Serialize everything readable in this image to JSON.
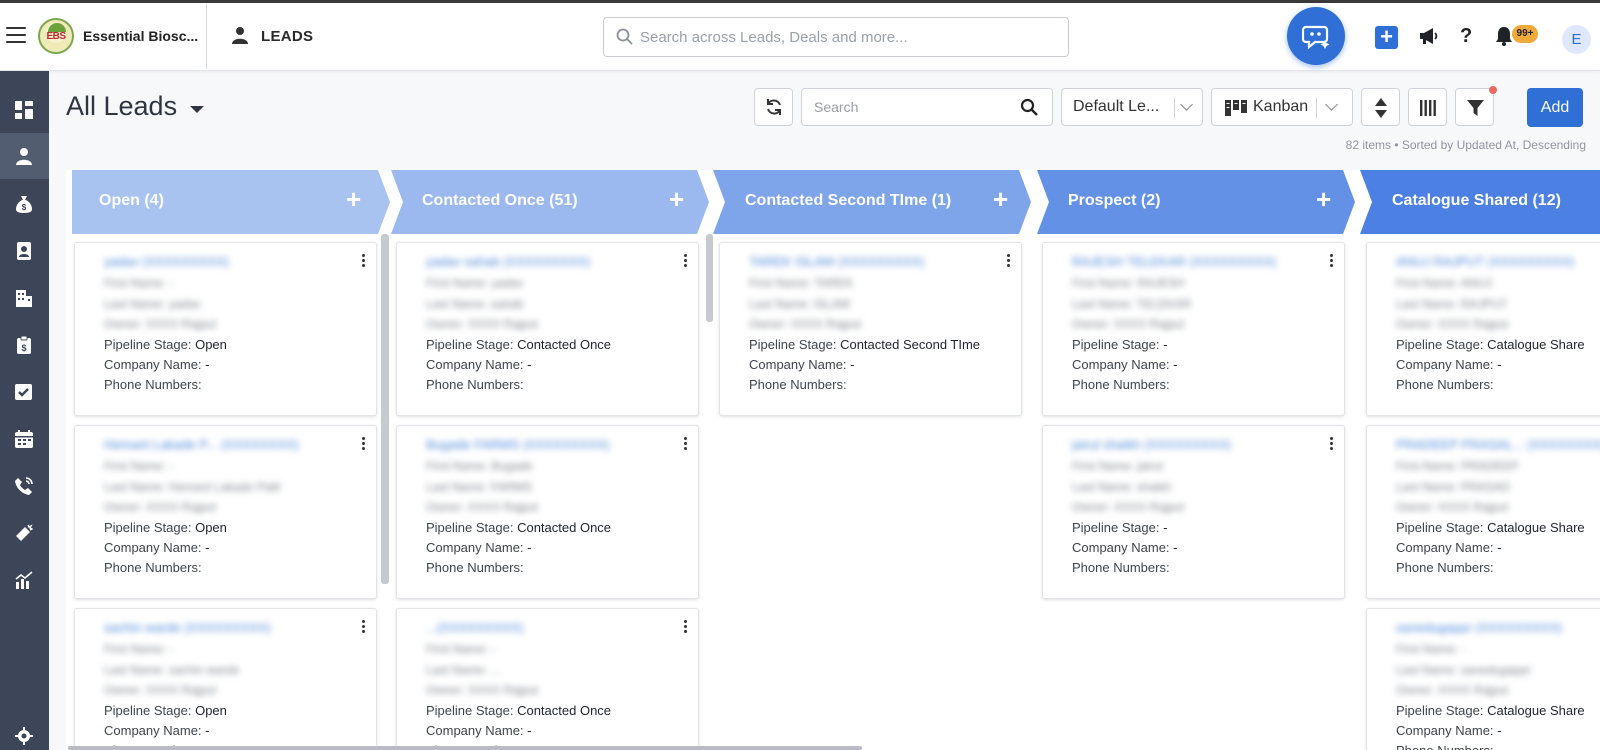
{
  "header": {
    "company_name": "Essential Biosc...",
    "logo_text": "EBS",
    "module_title": "LEADS",
    "search_placeholder": "Search across Leads, Deals and more...",
    "notification_badge": "99+",
    "avatar_initial": "E"
  },
  "sidebar": {
    "items": [
      {
        "icon": "dashboard-icon",
        "active": false
      },
      {
        "icon": "leads-person-icon",
        "active": true
      },
      {
        "icon": "deals-moneybag-icon",
        "active": false
      },
      {
        "icon": "contacts-icon",
        "active": false
      },
      {
        "icon": "companies-building-icon",
        "active": false
      },
      {
        "icon": "clipboard-icon",
        "active": false
      },
      {
        "icon": "tasks-checkbox-icon",
        "active": false
      },
      {
        "icon": "calendar-icon",
        "active": false
      },
      {
        "icon": "calls-icon",
        "active": false
      },
      {
        "icon": "campaigns-megaphone-icon",
        "active": false
      },
      {
        "icon": "reports-chart-icon",
        "active": false
      },
      {
        "icon": "settings-gear-icon",
        "active": false
      }
    ]
  },
  "toolbar": {
    "page_title": "All Leads",
    "search_placeholder": "Search",
    "view_select": "Default Le...",
    "layout_select": "Kanban",
    "add_label": "Add",
    "items_info": "82 items • Sorted by Updated At, Descending"
  },
  "labels": {
    "pipeline_stage": "Pipeline Stage: ",
    "company_name": "Company Name: ",
    "phone_numbers": "Phone Numbers:"
  },
  "stages": [
    {
      "label": "Open (4)",
      "color": "#a9c3f1",
      "cards": [
        {
          "name": "yadav (XXXXXXXXX)",
          "first": "First Name: -",
          "last": "Last Name: yadav",
          "owner": "Owner: XXXX Rajput",
          "stage": "Open",
          "company": "-"
        },
        {
          "name": "Hemant Lakade P... (XXXXXXXX)",
          "first": "First Name: -",
          "last": "Last Name: Hemant Lakade Patil",
          "owner": "Owner: XXXX Rajput",
          "stage": "Open",
          "company": "-"
        },
        {
          "name": "sachin warde (XXXXXXXXX)",
          "first": "First Name: -",
          "last": "Last Name: sachin warde",
          "owner": "Owner: XXXX Rajput",
          "stage": "Open",
          "company": "-"
        }
      ]
    },
    {
      "label": "Contacted Once (51)",
      "color": "#9bb9ef",
      "cards": [
        {
          "name": "yadav sahab (XXXXXXXXX)",
          "first": "First Name: yadav",
          "last": "Last Name: sahab",
          "owner": "Owner: XXXX Rajput",
          "stage": "Contacted Once",
          "company": "-"
        },
        {
          "name": "Bugade FARMS (XXXXXXXXX)",
          "first": "First Name: Bugade",
          "last": "Last Name: FARMS",
          "owner": "Owner: XXXX Rajput",
          "stage": "Contacted Once",
          "company": "-"
        },
        {
          "name": "...(XXXXXXXXX)",
          "first": "First Name: -",
          "last": "Last Name: ...",
          "owner": "Owner: XXXX Rajput",
          "stage": "Contacted Once",
          "company": "-"
        }
      ]
    },
    {
      "label": "Contacted Second TIme (1)",
      "color": "#7ea4ea",
      "cards": [
        {
          "name": "TAREK ISLAM (XXXXXXXXX)",
          "first": "First Name: TAREK",
          "last": "Last Name: ISLAM",
          "owner": "Owner: XXXX Rajput",
          "stage": "Contacted Second TIme",
          "company": "-"
        }
      ]
    },
    {
      "label": "Prospect (2)",
      "color": "#6391e6",
      "cards": [
        {
          "name": "RAJESH TELEKAR (XXXXXXXXX)",
          "first": "First Name: RAJESH",
          "last": "Last Name: TELEKAR",
          "owner": "Owner: XXXX Rajput",
          "stage": "-",
          "company": "-"
        },
        {
          "name": "jairul shaikh (XXXXXXXXX)",
          "first": "First Name: jairul",
          "last": "Last Name: shaikh",
          "owner": "Owner: XXXX Rajput",
          "stage": "-",
          "company": "-"
        }
      ]
    },
    {
      "label": "Catalogue Shared (12)",
      "color": "#4c80e2",
      "cards": [
        {
          "name": "ANUJ RAJPUT (XXXXXXXXX)",
          "first": "First Name: ANUJ",
          "last": "Last Name: RAJPUT",
          "owner": "Owner: XXXX Rajput",
          "stage": "Catalogue Share",
          "company": "-"
        },
        {
          "name": "PRADEEP PRASAL... (XXXXXXXX)",
          "first": "First Name: PRADEEP",
          "last": "Last Name: PRASAD",
          "owner": "Owner: XXXX Rajput",
          "stage": "Catalogue Share",
          "company": "-"
        },
        {
          "name": "sanedugappr (XXXXXXXXX)",
          "first": "First Name: -",
          "last": "Last Name: sanedugappr",
          "owner": "Owner: XXXX Rajput",
          "stage": "Catalogue Share",
          "company": "-"
        }
      ]
    }
  ]
}
